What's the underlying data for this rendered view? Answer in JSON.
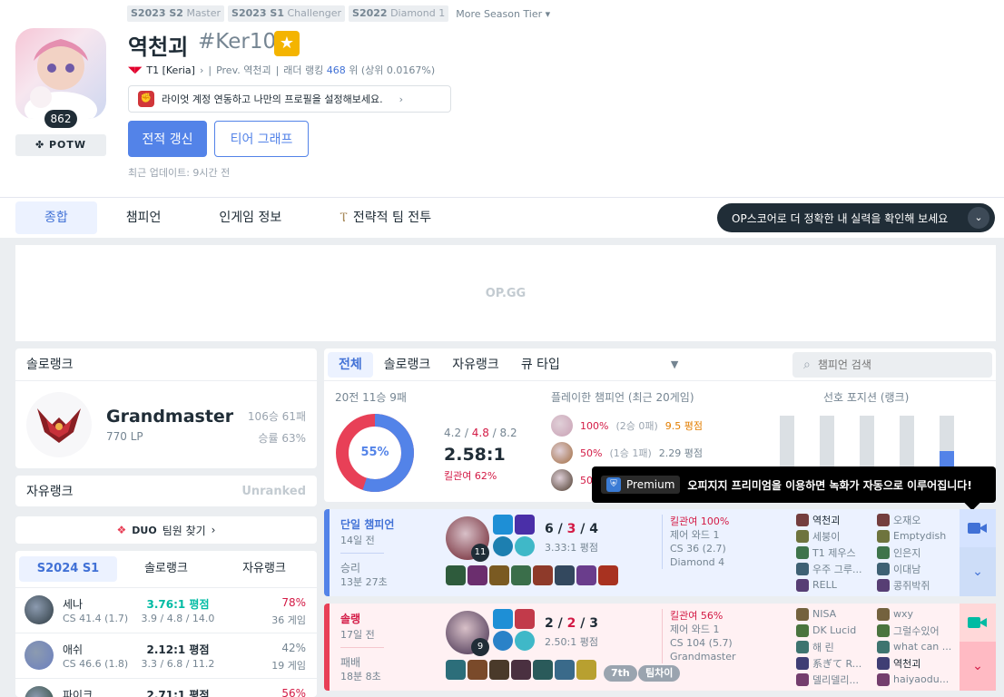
{
  "season_tiers": [
    {
      "season": "S2023 S2",
      "tier": "Master"
    },
    {
      "season": "S2023 S1",
      "tier": "Challenger"
    },
    {
      "season": "S2022",
      "tier": "Diamond 1"
    }
  ],
  "more_season_tier": "More Season Tier",
  "profile": {
    "level": "862",
    "potw": "POTW",
    "name": "역천괴",
    "tag": "#Ker10",
    "team": "T1 [Keria]",
    "prev": "Prev. 역천괴",
    "ladder_label": "래더 랭킹",
    "ladder_rank": "468",
    "ladder_suffix": "위 (상위 0.0167%)",
    "riot_link_text": "라이엇 계정 연동하고 나만의 프로필을 설정해보세요.",
    "refresh_label": "전적 갱신",
    "tier_graph_label": "티어 그래프",
    "updated": "최근 업데이트: 9시간 전"
  },
  "nav": {
    "tabs": [
      "종합",
      "챔피언",
      "인게임 정보",
      "전략적 팀 전투"
    ],
    "opscore_banner": "OP스코어로 더 정확한 내 실력을 확인해 보세요"
  },
  "ad": {
    "text": "OP.GG"
  },
  "solo_rank": {
    "title": "솔로랭크",
    "tier": "Grandmaster",
    "lp": "770 LP",
    "winloss": "106승 61패",
    "winrate": "승률 63%"
  },
  "flex_rank": {
    "title": "자유랭크",
    "status": "Unranked"
  },
  "duo": {
    "label": "DUO",
    "text": "팀원 찾기"
  },
  "season_stats": {
    "tabs": [
      "S2024 S1",
      "솔로랭크",
      "자유랭크"
    ],
    "champions": [
      {
        "name": "세나",
        "cs": "CS 41.4 (1.7)",
        "kda": "3.76:1 평점",
        "kda_detail": "3.9 / 4.8 / 14.0",
        "winrate": "78%",
        "games": "36 게임",
        "icon_color": "#2d3a40",
        "green": true
      },
      {
        "name": "애쉬",
        "cs": "CS 46.6 (1.8)",
        "kda": "2.12:1 평점",
        "kda_detail": "3.3 / 6.8 / 11.2",
        "winrate": "42%",
        "games": "19 게임",
        "icon_color": "#6b7fbf",
        "green": false
      },
      {
        "name": "파이크",
        "cs": "",
        "kda": "2.71:1 평점",
        "kda_detail": "",
        "winrate": "56%",
        "games": "",
        "icon_color": "#2f4a3b",
        "green": false
      }
    ]
  },
  "queue_tabs": {
    "tabs": [
      "전체",
      "솔로랭크",
      "자유랭크",
      "큐 타입"
    ],
    "search_placeholder": "챔피언 검색"
  },
  "summary": {
    "title": "20전 11승 9패",
    "winrate_pct": 55,
    "winrate_label": "55%",
    "kills": "4.2",
    "deaths": "4.8",
    "assists": "8.2",
    "kda_ratio": "2.58:1",
    "kill_participation": "킬관여 62%",
    "played_title": "플레이한 챔피언 (최근 20게임)",
    "played": [
      {
        "wr": "100%",
        "sub": "(2승 0패)",
        "kda": "9.5 평점",
        "orange": true,
        "color": "#c9a0b4"
      },
      {
        "wr": "50%",
        "sub": "(1승 1패)",
        "kda": "2.29 평점",
        "orange": false,
        "color": "#a06a3e"
      },
      {
        "wr": "50",
        "sub": "",
        "kda": "",
        "orange": false,
        "color": "#4b3a2c"
      }
    ],
    "position_title": "선호 포지션 (랭크)",
    "positions": [
      0,
      0,
      0,
      0,
      0.55
    ]
  },
  "tooltip": {
    "premium": "Premium",
    "text": "오피지지 프리미엄을 이용하면 녹화가 자동으로 이루어집니다!"
  },
  "matches": [
    {
      "result": "win",
      "type": "단일 챔피언",
      "ago": "14일 전",
      "outcome": "승리",
      "duration": "13분 27초",
      "level": "11",
      "kills": "6",
      "deaths": "3",
      "assists": "4",
      "kda_text": "3.33:1 평점",
      "kp": "킬관여 100%",
      "wards": "제어 와드 1",
      "cs": "CS 36 (2.7)",
      "tier": "Diamond 4",
      "badges": [],
      "team1": [
        "역천괴",
        "세붕이",
        "T1 제우스",
        "우주 그루...",
        "RELL"
      ],
      "team2": [
        "오재오",
        "Emptydish",
        "인은지",
        "이대남",
        "콩쥐박쥐"
      ]
    },
    {
      "result": "loss",
      "type": "솔랭",
      "ago": "17일 전",
      "outcome": "패배",
      "duration": "18분 8초",
      "level": "9",
      "kills": "2",
      "deaths": "2",
      "assists": "3",
      "kda_text": "2.50:1 평점",
      "kp": "킬관여 56%",
      "wards": "제어 와드 1",
      "cs": "CS 104 (5.7)",
      "tier": "Grandmaster",
      "badges": [
        "7th",
        "팀차이"
      ],
      "team1": [
        "NISA",
        "DK Lucid",
        "해 린",
        "系ぎて R...",
        "델리델리..."
      ],
      "team2": [
        "wxy",
        "그럴수있어",
        "what can ...",
        "역천괴",
        "haiyaodu..."
      ]
    }
  ],
  "colors": {
    "accent": "#5383e8",
    "loss": "#e84057",
    "win_bg": "#ecf2ff",
    "loss_bg": "#fff1f3"
  }
}
